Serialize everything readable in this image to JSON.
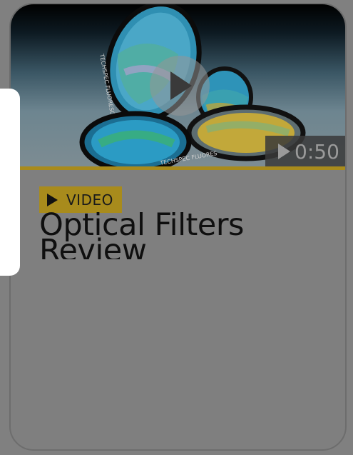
{
  "card": {
    "badge_label": "VIDEO",
    "title": "Optical Filters Review",
    "duration": "0:50",
    "thumbnail_alt": "Optical filters",
    "lens_ring_text": "TECHSPEC FLUORESCENCE",
    "lens_ring_text_short": "TECHSPEC FLUORES",
    "accent_color": "#a88b1c"
  }
}
